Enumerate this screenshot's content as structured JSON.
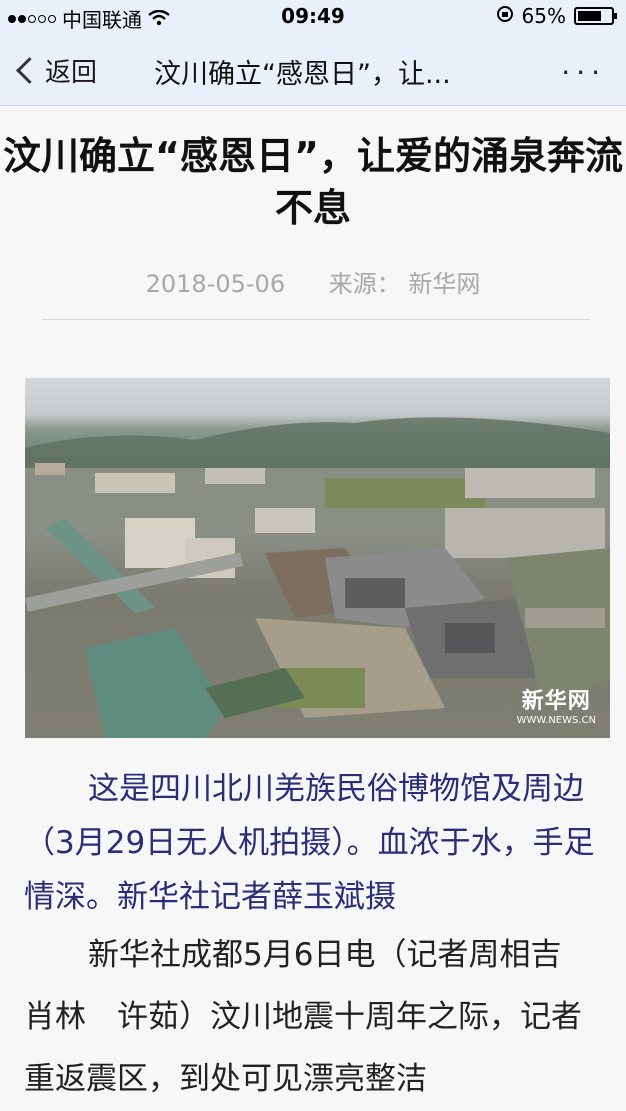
{
  "status_bar": {
    "carrier": "中国联通",
    "time": "09:49",
    "battery_percent": "65%",
    "battery_level": 0.65,
    "signal_bars_filled": 2,
    "signal_bars_total": 5
  },
  "nav": {
    "back_label": "返回",
    "title": "汶川确立“感恩日”，让...",
    "more_label": "···"
  },
  "article": {
    "title": "汶川确立“感恩日”，让爱的涌泉奔流不息",
    "date": "2018-05-06",
    "source": "来源： 新华网",
    "image_watermark_cn": "新华网",
    "image_watermark_en": "WWW.NEWS.CN",
    "caption": "这是四川北川羌族民俗博物馆及周边（3月29日无人机拍摄）。血浓于水，手足情深。新华社记者薛玉斌摄",
    "body": "新华社成都5月6日电（记者周相吉　肖林　许茹）汶川地震十周年之际，记者重返震区，到处可见漂亮整洁"
  },
  "colors": {
    "nav_bg": "#e9f0fa",
    "caption_text": "#2a2e7a",
    "meta_text": "#a8a8a8"
  }
}
